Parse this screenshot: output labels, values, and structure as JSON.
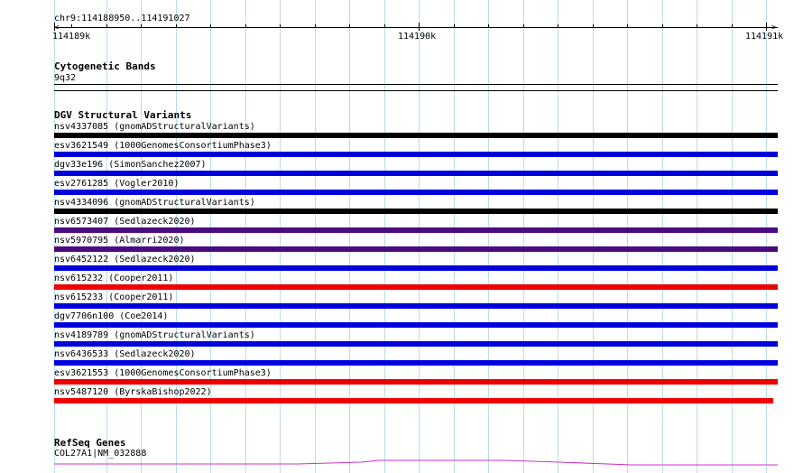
{
  "ruler": {
    "range_label": "chr9:114188950..114191027",
    "tick_labels": [
      "114189k",
      "114190k",
      "114191k"
    ]
  },
  "cytoband_track": {
    "title": "Cytogenetic Bands",
    "band_label": "9q32"
  },
  "dgv_track": {
    "title": "DGV Structural Variants",
    "variants": [
      {
        "label": "nsv4337085 (gnomADStructuralVariants)",
        "color": "#000000"
      },
      {
        "label": "esv3621549 (1000GenomesConsortiumPhase3)",
        "color": "#0000dd"
      },
      {
        "label": "dgv33e196 (SimonSanchez2007)",
        "color": "#0000dd"
      },
      {
        "label": "esv2761285 (Vogler2010)",
        "color": "#0000dd"
      },
      {
        "label": "nsv4334096 (gnomADStructuralVariants)",
        "color": "#000000"
      },
      {
        "label": "nsv6573407 (Sedlazeck2020)",
        "color": "#4b0a7d"
      },
      {
        "label": "nsv5970795 (Almarri2020)",
        "color": "#4b0a7d"
      },
      {
        "label": "nsv6452122 (Sedlazeck2020)",
        "color": "#0000dd"
      },
      {
        "label": "nsv615232 (Cooper2011)",
        "color": "#ee0000"
      },
      {
        "label": "nsv615233 (Cooper2011)",
        "color": "#0000dd"
      },
      {
        "label": "dgv7706n100 (Coe2014)",
        "color": "#0000dd"
      },
      {
        "label": "nsv4189789 (gnomADStructuralVariants)",
        "color": "#0000dd"
      },
      {
        "label": "nsv6436533 (Sedlazeck2020)",
        "color": "#0000dd"
      },
      {
        "label": "esv3621553 (1000GenomesConsortiumPhase3)",
        "color": "#ee0000"
      },
      {
        "label": "nsv5487120 (ByrskaBishop2022)",
        "color": "#ee0000"
      }
    ]
  },
  "refseq_track": {
    "title": "RefSeq Genes",
    "gene_label": "COL27A1|NM_032888",
    "color": "#cc33cc"
  }
}
